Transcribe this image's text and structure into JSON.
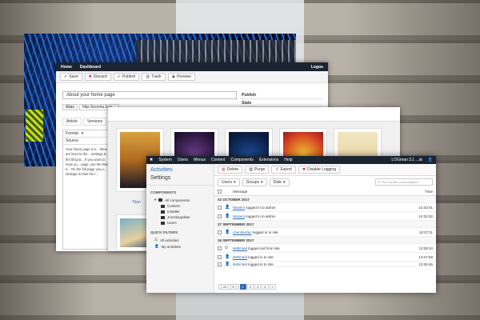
{
  "win_article": {
    "topbar": {
      "home": "Home",
      "dashboard": "Dashboard",
      "logout": "Logou"
    },
    "toolbar": {
      "save": "Save",
      "discard": "Discard",
      "publish": "Publish",
      "trash": "Trash",
      "preview": "Preview"
    },
    "title_value": "About your home page",
    "alias_label": "Alias",
    "alias_value": "http://joomla.boo",
    "tabs": [
      "Article",
      "Versions"
    ],
    "format_label": "Format",
    "source_label": "Source",
    "publish_header": "Publish",
    "state_label": "State",
    "body_text": "Your home page is s... there are lines to the... settings in the blog la... If you want to have yo... page, use the Read ti... On the full page you v... settings to hide the r..."
  },
  "win_media": {
    "caption": "Titan"
  },
  "win_logs": {
    "topbar": {
      "menus": [
        "System",
        "Users",
        "Menus",
        "Content",
        "Components",
        "Extensions",
        "Help"
      ],
      "brand": "LOGman 3.1 ...at"
    },
    "sidebar": {
      "heading": "Activities",
      "subheading": "Settings",
      "components_label": "COMPONENTS",
      "items": [
        "All components",
        "Content",
        "Installer",
        "Joomlaupdate",
        "Users"
      ],
      "quick_label": "QUICK FILTERS",
      "quick_items": [
        "All activities",
        "My activities"
      ]
    },
    "toolbar": {
      "delete": "Delete",
      "purge": "Purge",
      "export": "Export",
      "disable": "Disable Logging"
    },
    "filters": {
      "users": "Users",
      "groups": "Groups",
      "date": "Date",
      "search_placeholder": "Find by title or description..."
    },
    "table": {
      "col_message": "Message",
      "col_time": "Time",
      "groups": [
        {
          "date": "02 OCTOBER 2017",
          "rows": [
            {
              "user": "Wasem",
              "action": "logged in to admin",
              "time": "14:42:01"
            },
            {
              "user": "Wasem",
              "action": "logged in to admin",
              "time": "14:31:52"
            }
          ]
        },
        {
          "date": "27 SEPTEMBER 2017",
          "rows": [
            {
              "user": "chembertan",
              "action": "logged in to site",
              "time": "10:07:11"
            }
          ]
        },
        {
          "date": "26 SEPTEMBER 2017",
          "rows": [
            {
              "user": "kMlimted",
              "action": "logged out from site",
              "time": "13:29:10"
            },
            {
              "user": "kMlimted",
              "action": "logged in to site",
              "time": "13:27:58"
            },
            {
              "user": "kMlimted",
              "action": "logged in to site",
              "time": "13:26:46"
            }
          ]
        }
      ]
    },
    "pager": {
      "per_page": "20",
      "pages": [
        "1",
        "2",
        "3",
        "4",
        "»"
      ]
    }
  }
}
